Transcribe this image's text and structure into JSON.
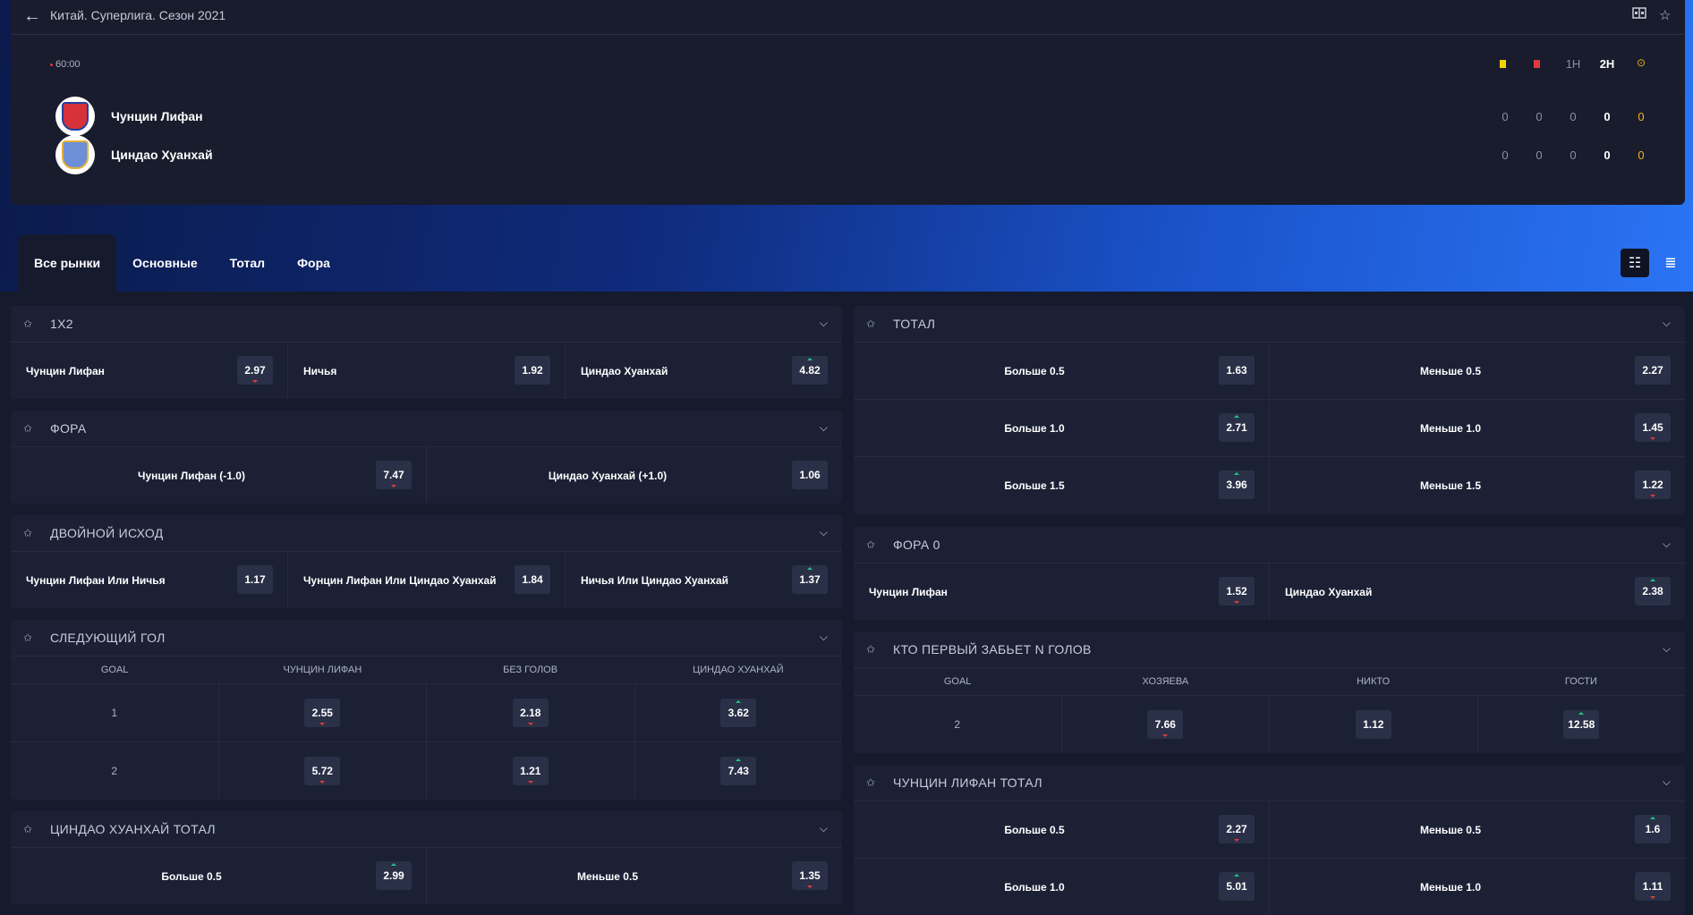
{
  "header": {
    "breadcrumb": "Китай. Суперлига. Сезон 2021",
    "time": "60:00",
    "periods": [
      "1H",
      "2H"
    ],
    "teams": [
      {
        "name": "Чунцин Лифан",
        "scores": [
          "0",
          "0",
          "0",
          "0",
          "0"
        ]
      },
      {
        "name": "Циндао Хуанхай",
        "scores": [
          "0",
          "0",
          "0",
          "0",
          "0"
        ]
      }
    ]
  },
  "tabs": [
    "Все рынки",
    "Основные",
    "Тотал",
    "Фора"
  ],
  "left": {
    "m1x2": {
      "title": "1X2",
      "cells": [
        {
          "label": "Чунцин Лифан",
          "odd": "2.97"
        },
        {
          "label": "Ничья",
          "odd": "1.92"
        },
        {
          "label": "Циндао Хуанхай",
          "odd": "4.82"
        }
      ]
    },
    "fora": {
      "title": "ФОРА",
      "cells": [
        {
          "label": "Чунцин Лифан (-1.0)",
          "odd": "7.47"
        },
        {
          "label": "Циндао Хуанхай (+1.0)",
          "odd": "1.06"
        }
      ]
    },
    "double": {
      "title": "ДВОЙНОЙ ИСХОД",
      "cells": [
        {
          "label": "Чунцин Лифан Или Ничья",
          "odd": "1.17"
        },
        {
          "label": "Чунцин Лифан Или Циндао Хуанхай",
          "odd": "1.84"
        },
        {
          "label": "Ничья Или Циндао Хуанхай",
          "odd": "1.37"
        }
      ]
    },
    "nextgoal": {
      "title": "СЛЕДУЮЩИЙ ГОЛ",
      "headers": [
        "Goal",
        "Чунцин Лифан",
        "Без голов",
        "Циндао Хуанхай"
      ],
      "rows": [
        {
          "goal": "1",
          "odds": [
            "2.55",
            "2.18",
            "3.62"
          ]
        },
        {
          "goal": "2",
          "odds": [
            "5.72",
            "1.21",
            "7.43"
          ]
        }
      ]
    },
    "qtotal": {
      "title": "ЦИНДАО ХУАНХАЙ ТОТАЛ",
      "cells": [
        {
          "label": "Больше 0.5",
          "odd": "2.99"
        },
        {
          "label": "Меньше 0.5",
          "odd": "1.35"
        }
      ]
    }
  },
  "right": {
    "total": {
      "title": "ТОТАЛ",
      "rows": [
        [
          {
            "label": "Больше 0.5",
            "odd": "1.63"
          },
          {
            "label": "Меньше 0.5",
            "odd": "2.27"
          }
        ],
        [
          {
            "label": "Больше 1.0",
            "odd": "2.71"
          },
          {
            "label": "Меньше 1.0",
            "odd": "1.45"
          }
        ],
        [
          {
            "label": "Больше 1.5",
            "odd": "3.96"
          },
          {
            "label": "Меньше 1.5",
            "odd": "1.22"
          }
        ]
      ]
    },
    "fora0": {
      "title": "ФОРА 0",
      "cells": [
        {
          "label": "Чунцин Лифан",
          "odd": "1.52"
        },
        {
          "label": "Циндао Хуанхай",
          "odd": "2.38"
        }
      ]
    },
    "firstn": {
      "title": "КТО ПЕРВЫЙ ЗАБЬЕТ N ГОЛОВ",
      "headers": [
        "Goal",
        "Хозяева",
        "Никто",
        "Гости"
      ],
      "rows": [
        {
          "goal": "2",
          "odds": [
            "7.66",
            "1.12",
            "12.58"
          ]
        }
      ]
    },
    "ctotal": {
      "title": "ЧУНЦИН ЛИФАН ТОТАЛ",
      "rows": [
        [
          {
            "label": "Больше 0.5",
            "odd": "2.27"
          },
          {
            "label": "Меньше 0.5",
            "odd": "1.6"
          }
        ],
        [
          {
            "label": "Больше 1.0",
            "odd": "5.01"
          },
          {
            "label": "Меньше 1.0",
            "odd": "1.11"
          }
        ]
      ]
    }
  }
}
